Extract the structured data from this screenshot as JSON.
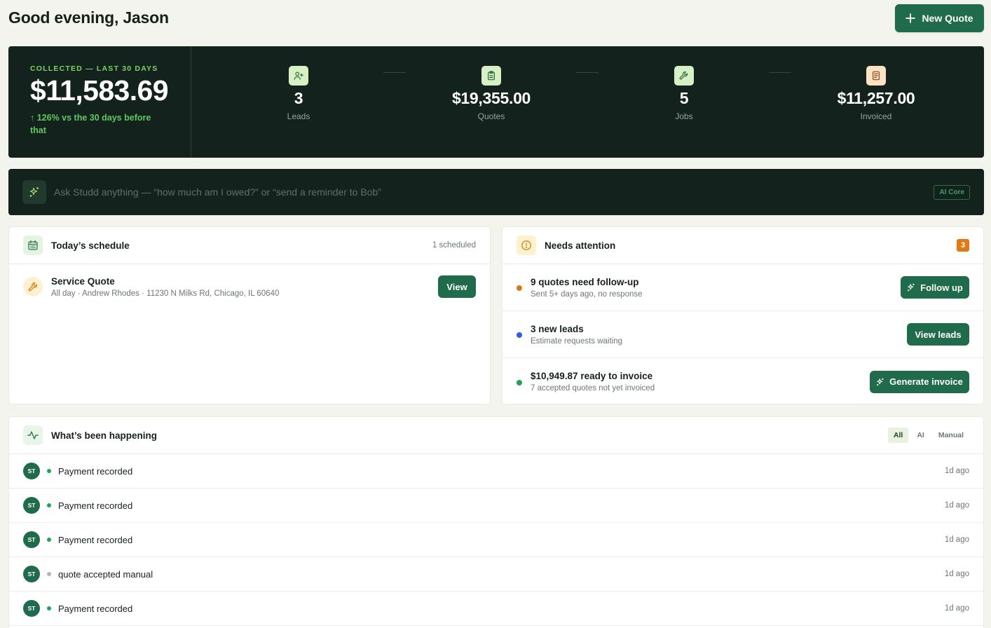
{
  "header": {
    "greeting": "Good evening, Jason",
    "new_quote_label": "New Quote"
  },
  "stats": {
    "collected_label": "COLLECTED — LAST 30 DAYS",
    "collected_amount": "$11,583.69",
    "collected_delta": "↑ 126% vs the 30 days before that",
    "metrics": [
      {
        "value": "3",
        "label": "Leads",
        "icon": "user-plus-icon"
      },
      {
        "value": "$19,355.00",
        "label": "Quotes",
        "icon": "clipboard-icon"
      },
      {
        "value": "5",
        "label": "Jobs",
        "icon": "wrench-icon"
      },
      {
        "value": "$11,257.00",
        "label": "Invoiced",
        "icon": "document-icon"
      }
    ]
  },
  "ai_bar": {
    "placeholder": "Ask Studd anything — “how much am I owed?” or “send a reminder to Bob”",
    "badge": "AI Core",
    "icon": "sparkles-icon"
  },
  "schedule": {
    "title": "Today’s schedule",
    "meta": "1 scheduled",
    "items": [
      {
        "title": "Service Quote",
        "subtitle": "All day · Andrew Rhodes · 11230 N Milks Rd, Chicago, IL 60640",
        "action": "View"
      }
    ]
  },
  "attention": {
    "title": "Needs attention",
    "count": "3",
    "items": [
      {
        "title": "9 quotes need follow-up",
        "subtitle": "Sent 5+ days ago, no response",
        "action": "Follow up",
        "dot_color": "#d97a14"
      },
      {
        "title": "3 new leads",
        "subtitle": "Estimate requests waiting",
        "action": "View leads",
        "dot_color": "#2f5fd8"
      },
      {
        "title": "$10,949.87 ready to invoice",
        "subtitle": "7 accepted quotes not yet invoiced",
        "action": "Generate invoice",
        "dot_color": "#22a353"
      }
    ]
  },
  "activity": {
    "title": "What’s been happening",
    "filters": [
      "All",
      "AI",
      "Manual"
    ],
    "active_filter": "All",
    "items": [
      {
        "avatar": "ST",
        "text": "Payment recorded",
        "time": "1d ago",
        "dot_color": "#22a353"
      },
      {
        "avatar": "ST",
        "text": "Payment recorded",
        "time": "1d ago",
        "dot_color": "#22a353"
      },
      {
        "avatar": "ST",
        "text": "Payment recorded",
        "time": "1d ago",
        "dot_color": "#22a353"
      },
      {
        "avatar": "ST",
        "text": "quote accepted manual",
        "time": "1d ago",
        "dot_color": "#b3b7b4"
      },
      {
        "avatar": "ST",
        "text": "Payment recorded",
        "time": "1d ago",
        "dot_color": "#22a353"
      }
    ]
  },
  "colors": {
    "brand_green": "#1f6b4c",
    "panel_dark": "#13221c",
    "accent_lime": "#7dd46b"
  }
}
